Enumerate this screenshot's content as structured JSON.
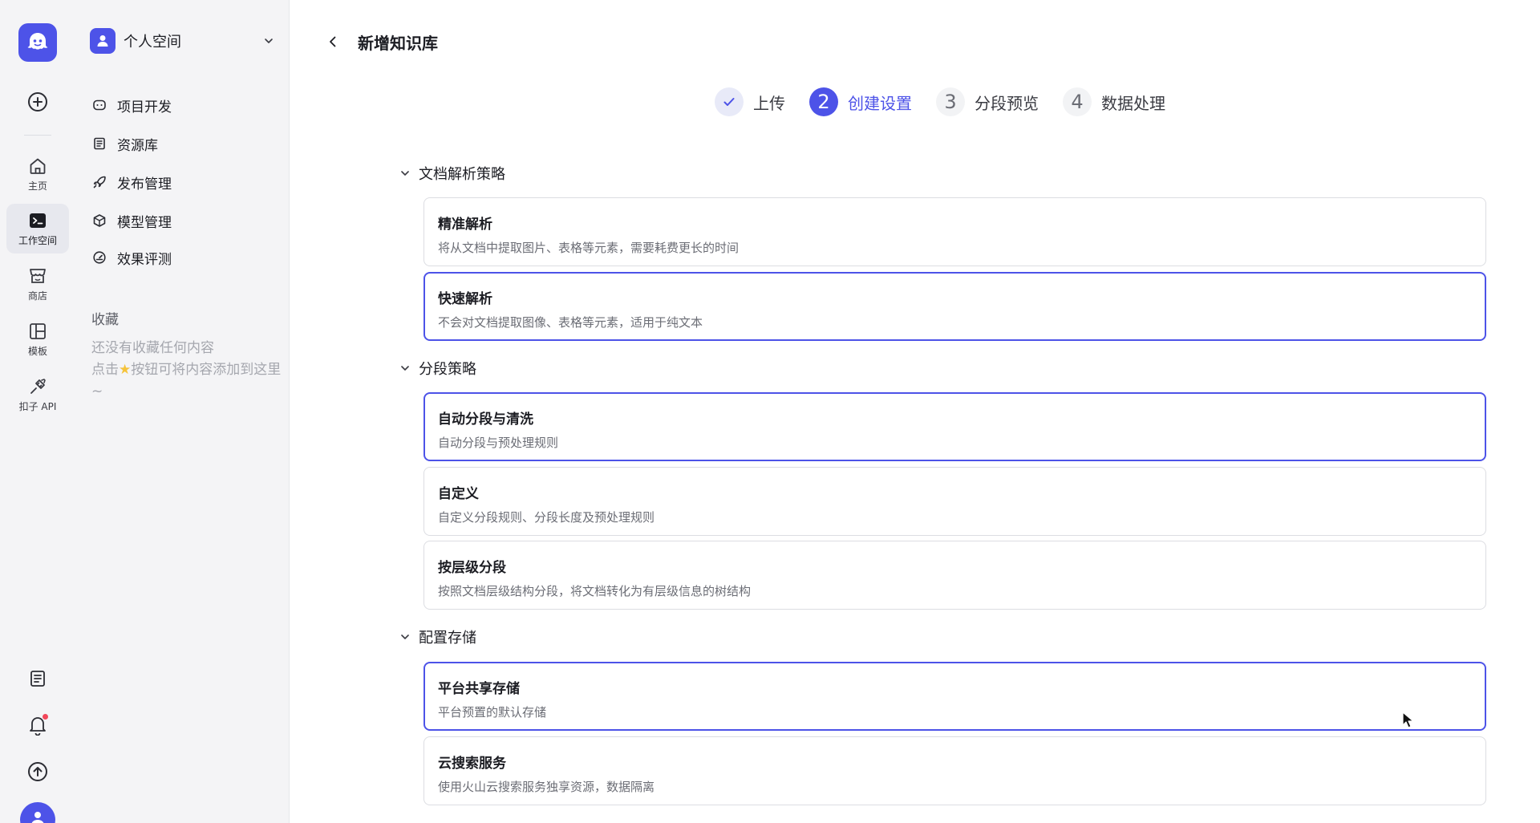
{
  "rail": {
    "items": [
      {
        "label": "主页",
        "icon": "home-icon"
      },
      {
        "label": "工作空间",
        "icon": "terminal-icon"
      },
      {
        "label": "商店",
        "icon": "store-icon"
      },
      {
        "label": "模板",
        "icon": "template-icon"
      },
      {
        "label": "扣子 API",
        "icon": "plug-icon"
      }
    ]
  },
  "sidebar": {
    "workspace": "个人空间",
    "items": [
      {
        "label": "项目开发",
        "icon": "gamepad-icon"
      },
      {
        "label": "资源库",
        "icon": "library-icon"
      },
      {
        "label": "发布管理",
        "icon": "rocket-icon"
      },
      {
        "label": "模型管理",
        "icon": "cube-icon"
      },
      {
        "label": "效果评测",
        "icon": "gauge-icon"
      }
    ],
    "favorites_title": "收藏",
    "favorites_empty_1": "还没有收藏任何内容",
    "favorites_empty_2": "点击",
    "favorites_empty_3": "按钮可将内容添加到这里~"
  },
  "header": {
    "title": "新增知识库"
  },
  "steps": [
    {
      "num": "",
      "label": "上传",
      "state": "done"
    },
    {
      "num": "2",
      "label": "创建设置",
      "state": "current"
    },
    {
      "num": "3",
      "label": "分段预览",
      "state": "todo"
    },
    {
      "num": "4",
      "label": "数据处理",
      "state": "todo"
    }
  ],
  "sections": {
    "parse": {
      "title": "文档解析策略",
      "options": [
        {
          "title": "精准解析",
          "desc": "将从文档中提取图片、表格等元素，需要耗费更长的时间",
          "selected": false
        },
        {
          "title": "快速解析",
          "desc": "不会对文档提取图像、表格等元素，适用于纯文本",
          "selected": true
        }
      ]
    },
    "segment": {
      "title": "分段策略",
      "options": [
        {
          "title": "自动分段与清洗",
          "desc": "自动分段与预处理规则",
          "selected": true
        },
        {
          "title": "自定义",
          "desc": "自定义分段规则、分段长度及预处理规则",
          "selected": false
        },
        {
          "title": "按层级分段",
          "desc": "按照文档层级结构分段，将文档转化为有层级信息的树结构",
          "selected": false
        }
      ]
    },
    "storage": {
      "title": "配置存储",
      "options": [
        {
          "title": "平台共享存储",
          "desc": "平台预置的默认存储",
          "selected": true
        },
        {
          "title": "云搜索服务",
          "desc": "使用火山云搜索服务独享资源，数据隔离",
          "selected": false
        }
      ]
    }
  },
  "colors": {
    "accent": "#4d53e8",
    "notification": "#f2475a"
  }
}
